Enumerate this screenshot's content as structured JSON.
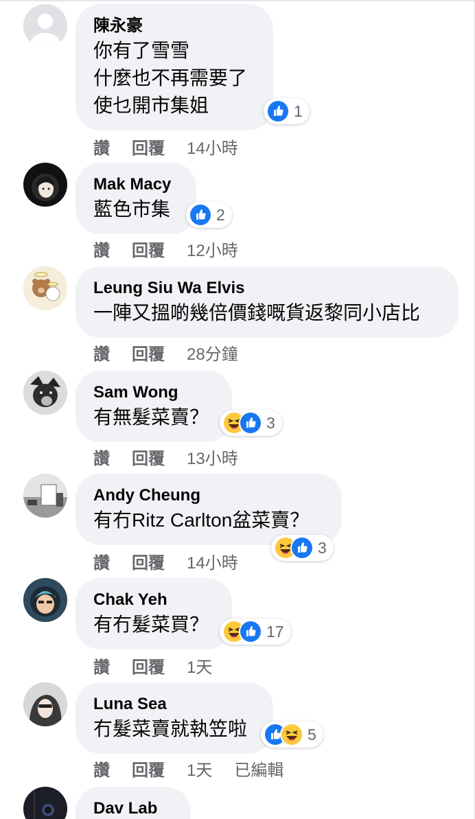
{
  "comments": [
    {
      "name": "陳永豪",
      "lines": "你有了雪雪\n什麼也不再需要了\n使乜開市集姐",
      "reactions": [
        "like"
      ],
      "count": "1",
      "like_label": "讚",
      "reply_label": "回覆",
      "time": "14小時",
      "edited": ""
    },
    {
      "name": "Mak Macy",
      "lines": "藍色市集",
      "reactions": [
        "like"
      ],
      "count": "2",
      "like_label": "讚",
      "reply_label": "回覆",
      "time": "12小時",
      "edited": ""
    },
    {
      "name": "Leung Siu Wa Elvis",
      "lines": "一陣又搵啲幾倍價錢嘅貨返黎同小店比",
      "reactions": [],
      "count": "",
      "like_label": "讚",
      "reply_label": "回覆",
      "time": "28分鐘",
      "edited": ""
    },
    {
      "name": "Sam Wong",
      "lines": "有無髮菜賣？",
      "reactions": [
        "haha",
        "like"
      ],
      "count": "3",
      "like_label": "讚",
      "reply_label": "回覆",
      "time": "13小時",
      "edited": ""
    },
    {
      "name": "Andy Cheung",
      "lines": "有冇Ritz Carlton盆菜賣？",
      "reactions": [
        "haha",
        "like"
      ],
      "count": "3",
      "like_label": "讚",
      "reply_label": "回覆",
      "time": "14小時",
      "edited": ""
    },
    {
      "name": "Chak Yeh",
      "lines": "有冇髮菜買？",
      "reactions": [
        "haha",
        "like"
      ],
      "count": "17",
      "like_label": "讚",
      "reply_label": "回覆",
      "time": "1天",
      "edited": ""
    },
    {
      "name": "Luna Sea",
      "lines": "冇髮菜賣就執笠啦",
      "reactions": [
        "like",
        "haha"
      ],
      "count": "5",
      "like_label": "讚",
      "reply_label": "回覆",
      "time": "1天",
      "edited": "已編輯"
    },
    {
      "name": "Dav Lab",
      "lines": "",
      "reactions": [],
      "count": "",
      "like_label": "",
      "reply_label": "",
      "time": "",
      "edited": ""
    }
  ],
  "colors": {
    "like_blue": "#1877f2",
    "haha_yellow": "#fcc93e",
    "meta_gray": "#65676b",
    "bubble_bg": "#f0f2f5"
  }
}
